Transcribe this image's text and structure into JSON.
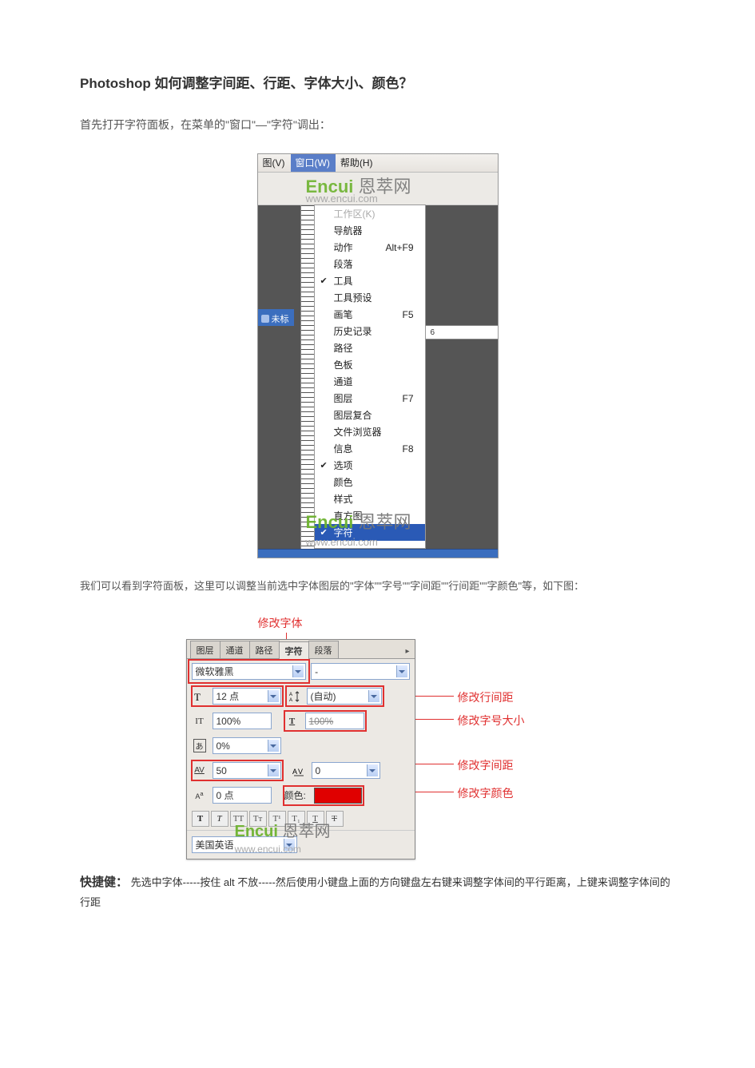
{
  "article": {
    "title": "Photoshop 如何调整字间距、行距、字体大小、颜色？",
    "intro": "首先打开字符面板，在菜单的\"窗口\"—\"字符\"调出：",
    "intro2": "我们可以看到字符面板，这里可以调整当前选中字体图层的\"字体\"\"字号\"\"字间距\"\"行间距\"\"字颜色\"等，如下图：",
    "shortcut_label": "快捷健：",
    "shortcut_text": "先选中字体-----按住 alt 不放-----然后使用小键盘上面的方向键盘左右键来调整字体间的平行距离，上键来调整字体间的行距"
  },
  "shot1": {
    "menubar": {
      "view": "图(V)",
      "window": "窗口(W)",
      "help": "帮助(H)"
    },
    "docTab": "未标",
    "dropdown": [
      {
        "label": "工作区(K)",
        "shortcut": "",
        "dim": true
      },
      {
        "label": "导航器",
        "shortcut": ""
      },
      {
        "label": "动作",
        "shortcut": "Alt+F9"
      },
      {
        "label": "段落",
        "shortcut": ""
      },
      {
        "label": "工具",
        "shortcut": "",
        "checked": true
      },
      {
        "label": "工具预设",
        "shortcut": ""
      },
      {
        "label": "画笔",
        "shortcut": "F5"
      },
      {
        "label": "历史记录",
        "shortcut": ""
      },
      {
        "label": "路径",
        "shortcut": ""
      },
      {
        "label": "色板",
        "shortcut": ""
      },
      {
        "label": "通道",
        "shortcut": ""
      },
      {
        "label": "图层",
        "shortcut": "F7"
      },
      {
        "label": "图层复合",
        "shortcut": ""
      },
      {
        "label": "文件浏览器",
        "shortcut": ""
      },
      {
        "label": "信息",
        "shortcut": "F8"
      },
      {
        "label": "选项",
        "shortcut": "",
        "checked": true
      },
      {
        "label": "颜色",
        "shortcut": ""
      },
      {
        "label": "样式",
        "shortcut": ""
      },
      {
        "label": "直方图",
        "shortcut": ""
      },
      {
        "label": "字符",
        "shortcut": "",
        "checked": true,
        "highlight": true
      }
    ],
    "watermark_brand": "Encui",
    "watermark_cn": " 恩萃网",
    "watermark_url": "www.encui.com",
    "rulerMark": "6"
  },
  "panel": {
    "top_annot": "修改字体",
    "tabs": [
      "图层",
      "通道",
      "路径",
      "字符",
      "段落"
    ],
    "active_tab_index": 3,
    "font_family": "微软雅黑",
    "font_style": "-",
    "font_size": "12 点",
    "leading": "(自动)",
    "v_scale": "100%",
    "h_scale": "100%",
    "tsume": "0%",
    "tracking": "50",
    "kerning": "0",
    "baseline": "0 点",
    "color_label": "颜色:",
    "color_value": "#e00000",
    "language": "美国英语",
    "annotations": {
      "leading": "修改行间距",
      "size": "修改字号大小",
      "tracking": "修改字间距",
      "color": "修改字颜色"
    },
    "watermark_brand": "Encui",
    "watermark_cn": " 恩萃网",
    "watermark_url": "www.encui.com"
  }
}
